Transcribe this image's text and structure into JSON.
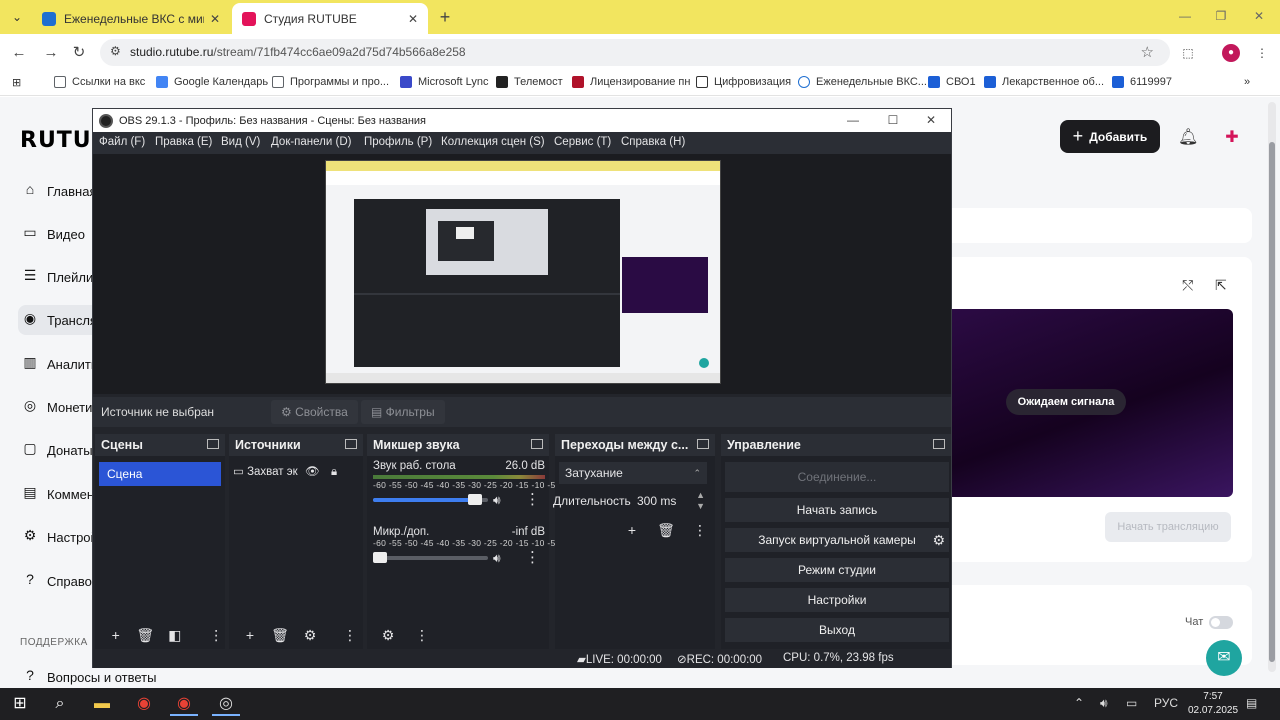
{
  "browser": {
    "tabs": [
      {
        "title": "Еженедельные ВКС с министр",
        "favicon_color": "#1f6fd1",
        "active": false
      },
      {
        "title": "Студия RUTUBE",
        "favicon_color": "#e3135a",
        "active": true
      }
    ],
    "url_host": "studio.rutube.ru",
    "url_path": "/stream/71fb474cc6ae09a2d75d74b566a8e258",
    "bookmarks": [
      {
        "label": "Ссылки на вкс",
        "icon": "folder-icon",
        "color": "#5f6368"
      },
      {
        "label": "Google Календарь",
        "icon": "calendar-icon",
        "color": "#4285f4"
      },
      {
        "label": "Программы и про...",
        "icon": "folder-icon",
        "color": "#5f6368"
      },
      {
        "label": "Microsoft Lync",
        "icon": "lync-icon",
        "color": "#3a49c9"
      },
      {
        "label": "Телемост",
        "icon": "telemost-icon",
        "color": "#222222"
      },
      {
        "label": "Лицензирование пн",
        "icon": "card-icon",
        "color": "#b0122a"
      },
      {
        "label": "Цифровизация",
        "icon": "m-icon",
        "color": "#333333"
      },
      {
        "label": "Еженедельные ВКС...",
        "icon": "globe-icon",
        "color": "#1f6fd1"
      },
      {
        "label": "СВО1",
        "icon": "video-icon",
        "color": "#1c5fd6"
      },
      {
        "label": "Лекарственное об...",
        "icon": "video-icon",
        "color": "#1c5fd6"
      },
      {
        "label": "6119997",
        "icon": "video-icon",
        "color": "#1c5fd6"
      }
    ]
  },
  "rutube": {
    "logo": "RUTU",
    "nav": [
      {
        "label": "Главная",
        "icon": "home-icon"
      },
      {
        "label": "Видео",
        "icon": "video-icon"
      },
      {
        "label": "Плейли",
        "icon": "playlist-icon"
      },
      {
        "label": "Трансля",
        "icon": "broadcast-icon",
        "active": true
      },
      {
        "label": "Аналити",
        "icon": "analytics-icon"
      },
      {
        "label": "Монетиз",
        "icon": "money-icon"
      },
      {
        "label": "Донаты",
        "icon": "donate-icon"
      },
      {
        "label": "Коммен",
        "icon": "comment-icon"
      },
      {
        "label": "Настрой",
        "icon": "settings-icon"
      },
      {
        "label": "Справоч",
        "icon": "help-icon"
      }
    ],
    "support_label": "ПОДДЕРЖКА",
    "faq_label": "Вопросы и ответы",
    "add_button": "Добавить",
    "waiting_signal": "Ожидаем сигнала",
    "start_stream": "Начать трансляцию",
    "chat_label": "Чат"
  },
  "obs": {
    "title": "OBS 29.1.3 - Профиль: Без названия - Сцены: Без названия",
    "menu": [
      "Файл (F)",
      "Правка (E)",
      "Вид (V)",
      "Док-панели (D)",
      "Профиль (P)",
      "Коллекция сцен (S)",
      "Сервис (T)",
      "Справка (H)"
    ],
    "no_source": "Источник не выбран",
    "properties": "Свойства",
    "filters": "Фильтры",
    "docks": {
      "scenes": "Сцены",
      "sources": "Источники",
      "mixer": "Микшер звука",
      "transitions": "Переходы между с...",
      "controls": "Управление"
    },
    "scene_items": [
      "Сцена"
    ],
    "source_items": [
      "Захват эк"
    ],
    "mixer": [
      {
        "name": "Звук раб. стола",
        "db": "26.0 dB",
        "level": 0.95
      },
      {
        "name": "Микр./доп.",
        "db": "-inf dB",
        "level": 0.0
      }
    ],
    "meter_scale": "-60 -55 -50 -45 -40 -35 -30 -25 -20 -15 -10 -5 0",
    "transition": {
      "type": "Затухание",
      "duration_label": "Длительность",
      "duration": "300 ms"
    },
    "controls": {
      "connecting": "Соединение...",
      "start_recording": "Начать запись",
      "virtual_camera": "Запуск виртуальной камеры",
      "studio_mode": "Режим студии",
      "settings": "Настройки",
      "exit": "Выход"
    },
    "status": {
      "live": "LIVE: 00:00:00",
      "rec": "REC: 00:00:00",
      "cpu": "CPU: 0.7%, 23.98 fps"
    }
  },
  "taskbar": {
    "lang": "РУС",
    "time": "7:57",
    "date": "02.07.2025"
  }
}
